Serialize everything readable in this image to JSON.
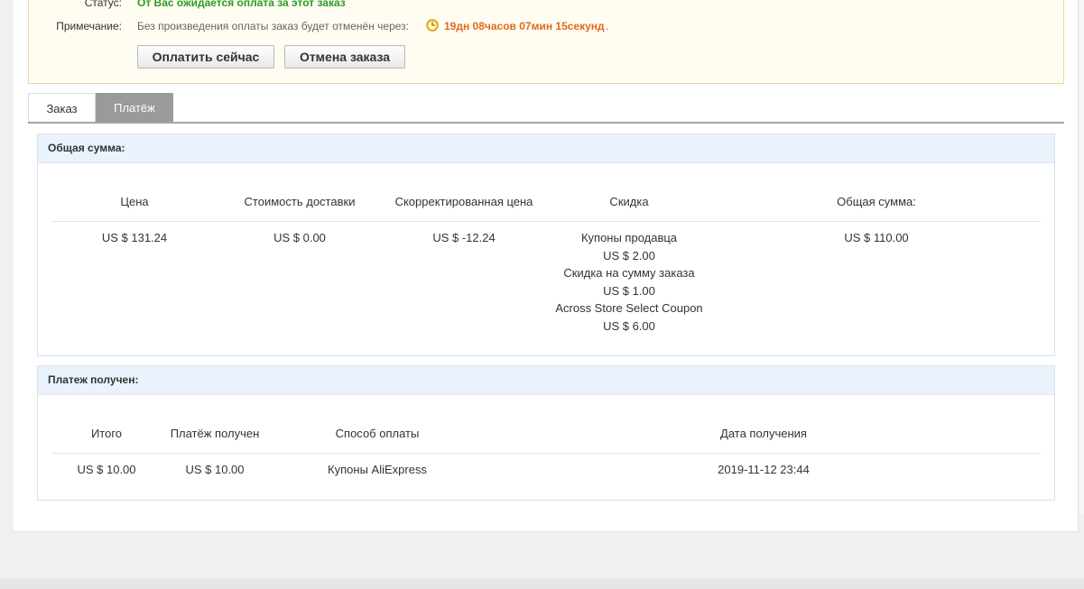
{
  "status": {
    "label": "Статус:",
    "value": "От Вас ожидается оплата за этот заказ",
    "note_label": "Примечание:",
    "note_text": "Без произведения оплаты заказ будет отменён через:",
    "countdown": "19дн 08часов 07мин 15секунд",
    "countdown_suffix": ".",
    "pay_button": "Оплатить сейчас",
    "cancel_button": "Отмена заказа",
    "accent_green": "#2b9a25",
    "accent_orange": "#e16a1d"
  },
  "tabs": [
    {
      "label": "Заказ",
      "active": false
    },
    {
      "label": "Платёж",
      "active": true
    }
  ],
  "total_section": {
    "title": "Общая сумма:",
    "headers": [
      "Цена",
      "Стоимость доставки",
      "Скорректированная цена",
      "Скидка",
      "Общая сумма:"
    ],
    "price": "US $ 131.24",
    "shipping": "US $ 0.00",
    "adjusted": "US $ -12.24",
    "discounts": [
      "Купоны продавца",
      "US $ 2.00",
      "Скидка на сумму заказа",
      "US $ 1.00",
      "Across Store Select Coupon",
      "US $ 6.00"
    ],
    "total": "US $ 110.00"
  },
  "received_section": {
    "title": "Платеж получен:",
    "headers": [
      "Итого",
      "Платёж получен",
      "Способ оплаты",
      "Дата получения"
    ],
    "row": [
      "US $ 10.00",
      "US $ 10.00",
      "Купоны AliExpress",
      "2019-11-12 23:44"
    ]
  },
  "icons": {
    "countdown": "clock-icon"
  }
}
